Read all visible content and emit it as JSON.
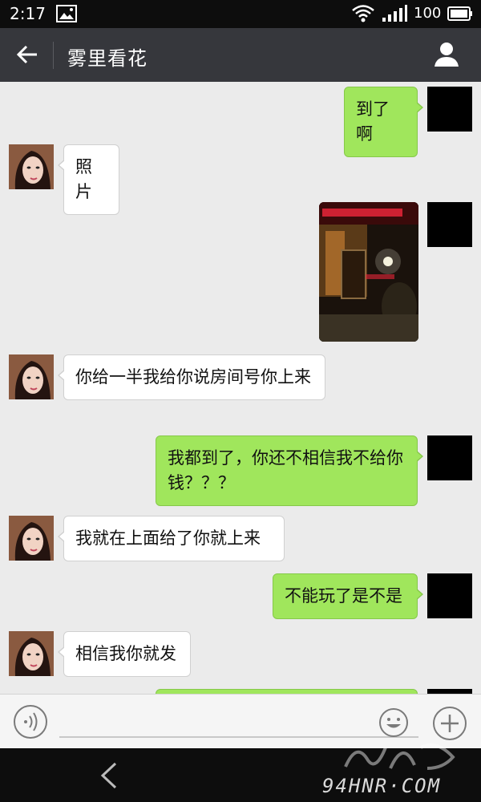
{
  "status_bar": {
    "time": "2:17",
    "battery": "100",
    "icons": [
      "gallery-icon",
      "wifi-icon",
      "signal-icon",
      "battery-icon"
    ]
  },
  "header": {
    "title": "雾里看花",
    "back_icon": "arrow-left-icon",
    "profile_icon": "person-icon"
  },
  "messages": [
    {
      "direction": "out",
      "type": "text",
      "text": "到了啊"
    },
    {
      "direction": "in",
      "type": "text",
      "text": "照片"
    },
    {
      "direction": "out",
      "type": "image",
      "image": "night-building-photo"
    },
    {
      "direction": "in",
      "type": "text",
      "text": "你给一半我给你说房间号你上来"
    },
    {
      "direction": "out",
      "type": "text",
      "text": "我都到了，你还不相信我不给你钱？？？"
    },
    {
      "direction": "in",
      "type": "text",
      "text": "我就在上面给了你就上来"
    },
    {
      "direction": "out",
      "type": "text",
      "text": "不能玩了是不是"
    },
    {
      "direction": "in",
      "type": "text",
      "text": "相信我你就发"
    }
  ],
  "input_bar": {
    "voice_icon": "voice-icon",
    "emoji_icon": "emoji-icon",
    "plus_icon": "plus-icon"
  },
  "watermark": {
    "text": "94HNR·COM"
  },
  "colors": {
    "header_bg": "#36373c",
    "chat_bg": "#ebebeb",
    "outgoing_bubble": "#a0e65c",
    "incoming_bubble": "#ffffff"
  }
}
